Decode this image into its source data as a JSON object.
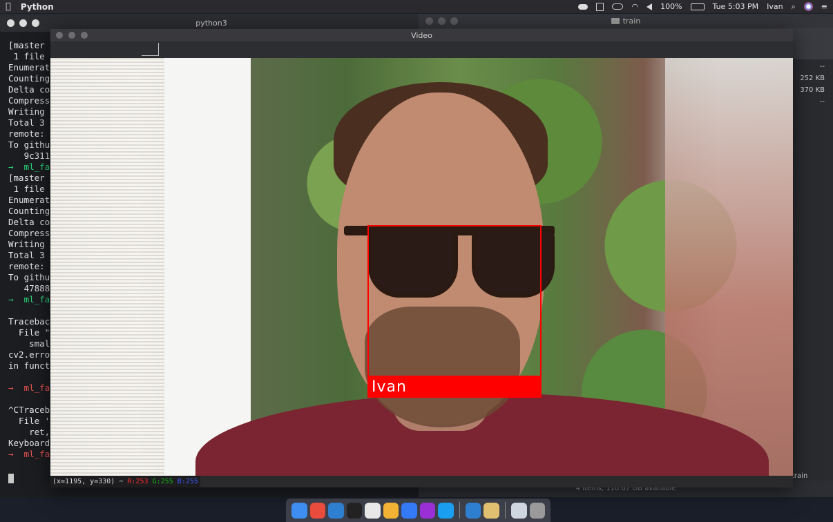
{
  "menubar": {
    "apple": "",
    "app_name": "Python",
    "battery": "100%",
    "clock": "Tue 5:03 PM",
    "user": "Ivan"
  },
  "terminal": {
    "title": "python3",
    "lines": [
      {
        "text": "[master",
        "style": ""
      },
      {
        "text": " 1 file",
        "style": ""
      },
      {
        "text": "Enumerat",
        "style": ""
      },
      {
        "text": "Counting",
        "style": ""
      },
      {
        "text": "Delta co",
        "style": ""
      },
      {
        "text": "Compress",
        "style": ""
      },
      {
        "text": "Writing",
        "style": ""
      },
      {
        "text": "Total 3",
        "style": ""
      },
      {
        "text": "remote:",
        "style": ""
      },
      {
        "text": "To githu",
        "style": ""
      },
      {
        "text": "   9c311",
        "style": ""
      },
      {
        "text": "→  ml_fa",
        "style": "green"
      },
      {
        "text": "[master",
        "style": ""
      },
      {
        "text": " 1 file",
        "style": ""
      },
      {
        "text": "Enumerat",
        "style": ""
      },
      {
        "text": "Counting",
        "style": ""
      },
      {
        "text": "Delta co",
        "style": ""
      },
      {
        "text": "Compress",
        "style": ""
      },
      {
        "text": "Writing",
        "style": ""
      },
      {
        "text": "Total 3",
        "style": ""
      },
      {
        "text": "remote:",
        "style": ""
      },
      {
        "text": "To githu",
        "style": ""
      },
      {
        "text": "   47888",
        "style": ""
      },
      {
        "text": "→  ml_fa",
        "style": "green"
      },
      {
        "text": "",
        "style": ""
      },
      {
        "text": "Tracebac",
        "style": ""
      },
      {
        "text": "  File \"",
        "style": ""
      },
      {
        "text": "    smal",
        "style": ""
      },
      {
        "text": "cv2.erro",
        "style": ""
      },
      {
        "text": "in funct",
        "style": ""
      },
      {
        "text": "",
        "style": ""
      },
      {
        "text": "→  ml_fa",
        "style": "red"
      },
      {
        "text": "",
        "style": ""
      },
      {
        "text": "^CTraceb",
        "style": ""
      },
      {
        "text": "  File '",
        "style": ""
      },
      {
        "text": "    ret,",
        "style": ""
      },
      {
        "text": "Keyboard",
        "style": ""
      },
      {
        "text": "→  ml_fa",
        "style": "red"
      }
    ]
  },
  "finder": {
    "title": "train",
    "sizes": [
      "--",
      "252 KB",
      "370 KB",
      "--"
    ],
    "sidebar_label": "train",
    "status": "4 items, 110.67 GB available"
  },
  "video": {
    "title": "Video",
    "face_label": "Ivan",
    "status_coords": "(x=1195, y=330) ~",
    "status_r": "R:253",
    "status_g": "G:255",
    "status_b": "B:255"
  },
  "dock": {
    "apps": [
      "finder-icon",
      "chrome-icon",
      "vscode-icon",
      "terminal-icon",
      "slack-icon",
      "sequel-icon",
      "maps-icon",
      "phpstorm-icon",
      "skype-icon",
      "vscode-icon",
      "pen-icon",
      "preview-icon",
      "trash-icon"
    ],
    "colors": [
      "#3d8ef0",
      "#e94b3c",
      "#2f7fd1",
      "#222222",
      "#e8e8e8",
      "#f2b233",
      "#3479f6",
      "#9b2fd6",
      "#1a9ff0",
      "#2f7fd1",
      "#e0c070",
      "#cfd6e0",
      "#9a9a9a"
    ]
  }
}
